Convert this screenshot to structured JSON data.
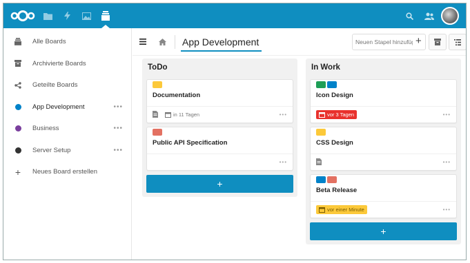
{
  "colors": {
    "header": "#0f8ec0",
    "accent": "#0f8ec0",
    "yellow": "#fcc93a",
    "red": "#e9322d",
    "green": "#1e9e57",
    "blue": "#0082c9",
    "salmon": "#e37162"
  },
  "header": {
    "apps": [
      "files-icon",
      "activity-icon",
      "gallery-icon",
      "deck-icon"
    ],
    "right_icons": [
      "search-icon",
      "contacts-icon",
      "avatar"
    ]
  },
  "sidebar": {
    "items": [
      {
        "label": "Alle Boards",
        "icon": "boards-icon"
      },
      {
        "label": "Archivierte Boards",
        "icon": "archive-icon"
      },
      {
        "label": "Geteilte Boards",
        "icon": "share-icon"
      },
      {
        "label": "App Development",
        "color": "#0082c9",
        "more": "•••"
      },
      {
        "label": "Business",
        "color": "#7a3f9d",
        "more": "•••"
      },
      {
        "label": "Server Setup",
        "color": "#333333",
        "more": "•••"
      },
      {
        "label": "Neues Board erstellen",
        "icon": "plus-icon"
      }
    ]
  },
  "main": {
    "board_title": "App Development",
    "new_stack_placeholder": "Neuen Stapel hinzufügen",
    "stacks": [
      {
        "title": "ToDo",
        "cards": [
          {
            "title": "Documentation",
            "labels": [
              "#fcc93a"
            ],
            "due": "in 11 Tagen",
            "due_style": "plain",
            "has_desc": true,
            "more": "•••"
          },
          {
            "title": "Public API Specification",
            "labels": [
              "#e37162"
            ],
            "due": "",
            "has_desc": false,
            "more": "•••"
          }
        ],
        "add_label": "+"
      },
      {
        "title": "In Work",
        "cards": [
          {
            "title": "Icon Design",
            "labels": [
              "#1e9e57",
              "#0082c9"
            ],
            "due": "vor 3 Tagen",
            "due_style": "overdue",
            "has_desc": false,
            "more": "•••"
          },
          {
            "title": "CSS Design",
            "labels": [
              "#fcc93a"
            ],
            "due": "",
            "has_desc": true,
            "more": "•••"
          },
          {
            "title": "Beta Release",
            "labels": [
              "#0082c9",
              "#e37162"
            ],
            "due": "vor einer Minute",
            "due_style": "soon",
            "has_desc": false,
            "more": "•••"
          }
        ],
        "add_label": "+"
      }
    ]
  }
}
